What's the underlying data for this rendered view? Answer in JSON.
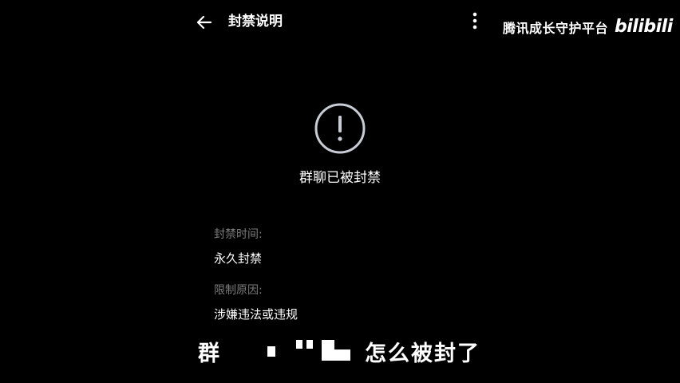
{
  "header": {
    "title": "封禁说明",
    "back_icon": "arrow-left-icon",
    "more_icon": "more-vertical-icon"
  },
  "watermark": {
    "text": "腾讯成长守护平台",
    "logo": "bilibili"
  },
  "status": {
    "icon": "alert-circle-icon",
    "text": "群聊已被封禁"
  },
  "details": {
    "time_label": "封禁时间:",
    "time_value": "永久封禁",
    "reason_label": "限制原因:",
    "reason_value": "涉嫌违法或违规"
  },
  "subtitle": {
    "prefix": "群",
    "suffix": "怎么被封了"
  },
  "colors": {
    "background": "#000000",
    "text_primary": "#ffffff",
    "text_muted": "#7b7b7b",
    "icon_ring": "#c8ccd4"
  }
}
